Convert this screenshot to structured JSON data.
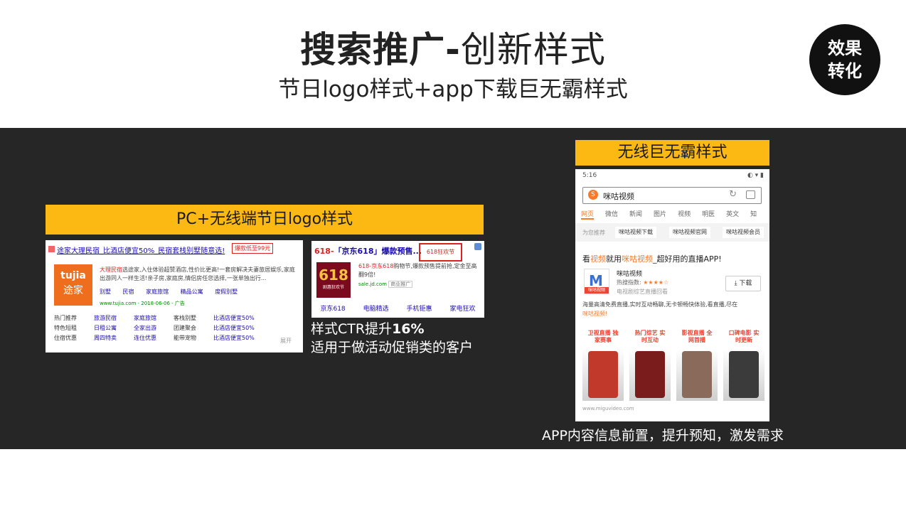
{
  "title": {
    "bold": "搜索推广-",
    "light": "创新样式"
  },
  "subtitle": "节日logo样式+app下载巨无霸样式",
  "badge": {
    "line1": "效果",
    "line2": "转化"
  },
  "pc_section": {
    "label": "PC+无线端节日logo样式",
    "tujia_ad": {
      "title": "途家大理民宿_比酒店便宜50%_民宿套栈别墅随意选!",
      "tag": "爆款低至99元",
      "logo_top": "tujia",
      "logo_bottom": "途家",
      "desc_red": "大理民宿",
      "desc": "选途家,入住体验超赞酒店,性价比更高!一套房解决夫妻旅居娱乐,家庭出游同人一样生活!亲子房,家庭房,情侣房任您选择,一张单独出行...",
      "links": [
        "别墅",
        "民宿",
        "家庭旅馆",
        "精品公寓",
        "度假别墅"
      ],
      "url": "www.tujia.com - 2018-06-06 - 广告",
      "grid": [
        [
          "热门推荐",
          "旅游民宿",
          "家庭旅馆",
          "客栈别墅",
          "比酒店便宜50%"
        ],
        [
          "特色短租",
          "日租公寓",
          "全家出游",
          "团建聚会",
          "比酒店便宜50%"
        ],
        [
          "住宿优惠",
          "周四特卖",
          "连住优惠",
          "能带宠物",
          "比酒店便宜50%"
        ]
      ],
      "more": "展开"
    },
    "jd_ad": {
      "title_red": "618-",
      "title": "「京东618」爆款预售...",
      "tag": "618狂欢节",
      "logo_num": "618",
      "logo_sub": "剧惠狂欢节",
      "desc_red": "618-京东618",
      "desc": "购物节,爆款预售提前抢,定金至高翻9倍!",
      "url": "sale.jd.com",
      "url_tag": "商业推广",
      "links": [
        "京东618",
        "电脑精选",
        "手机钜惠",
        "家电狂欢"
      ]
    },
    "ctr_prefix": "样式CTR提升",
    "ctr_value": "16%",
    "note": "适用于做活动促销类的客户"
  },
  "app_section": {
    "label": "无线巨无霸样式",
    "status_time": "5:16",
    "status_icons": "◐ ▾ ▮",
    "search_text": "咪咕视频",
    "tabs": [
      "网页",
      "微信",
      "新闻",
      "图片",
      "视频",
      "明医",
      "英文",
      "知"
    ],
    "rec_label": "为您推荐",
    "rec_chips": [
      "咪咕视频下载",
      "咪咕视频官网",
      "咪咕视频会员"
    ],
    "headline_a": "看",
    "headline_b": "视频",
    "headline_c": "就用",
    "headline_d": "咪咕视频",
    "headline_e": "_超好用的直播APP!",
    "app_icon_sub": "咪咕视频",
    "app_name": "咪咕视频",
    "app_hot_label": "热搜指数:",
    "app_hot_stars": "★★★★☆",
    "app_category": "电视剧综艺直播回看",
    "download": "下载",
    "body": "海量高清免费直播,实时互动畅聊,无卡顿畅快体验,看直播,尽在",
    "body_end": "咪咕视频!",
    "shots": [
      {
        "caption": "卫视直播 独家赛事",
        "color": "#c0392b"
      },
      {
        "caption": "热门综艺 实时互动",
        "color": "#7a1c1c"
      },
      {
        "caption": "影视直播 全网首播",
        "color": "#8a6a5a"
      },
      {
        "caption": "口碑电影 实时更新",
        "color": "#3b3b3b"
      }
    ],
    "foot_url": "www.miguvideo.com",
    "note": "APP内容信息前置，提升预知，激发需求"
  }
}
